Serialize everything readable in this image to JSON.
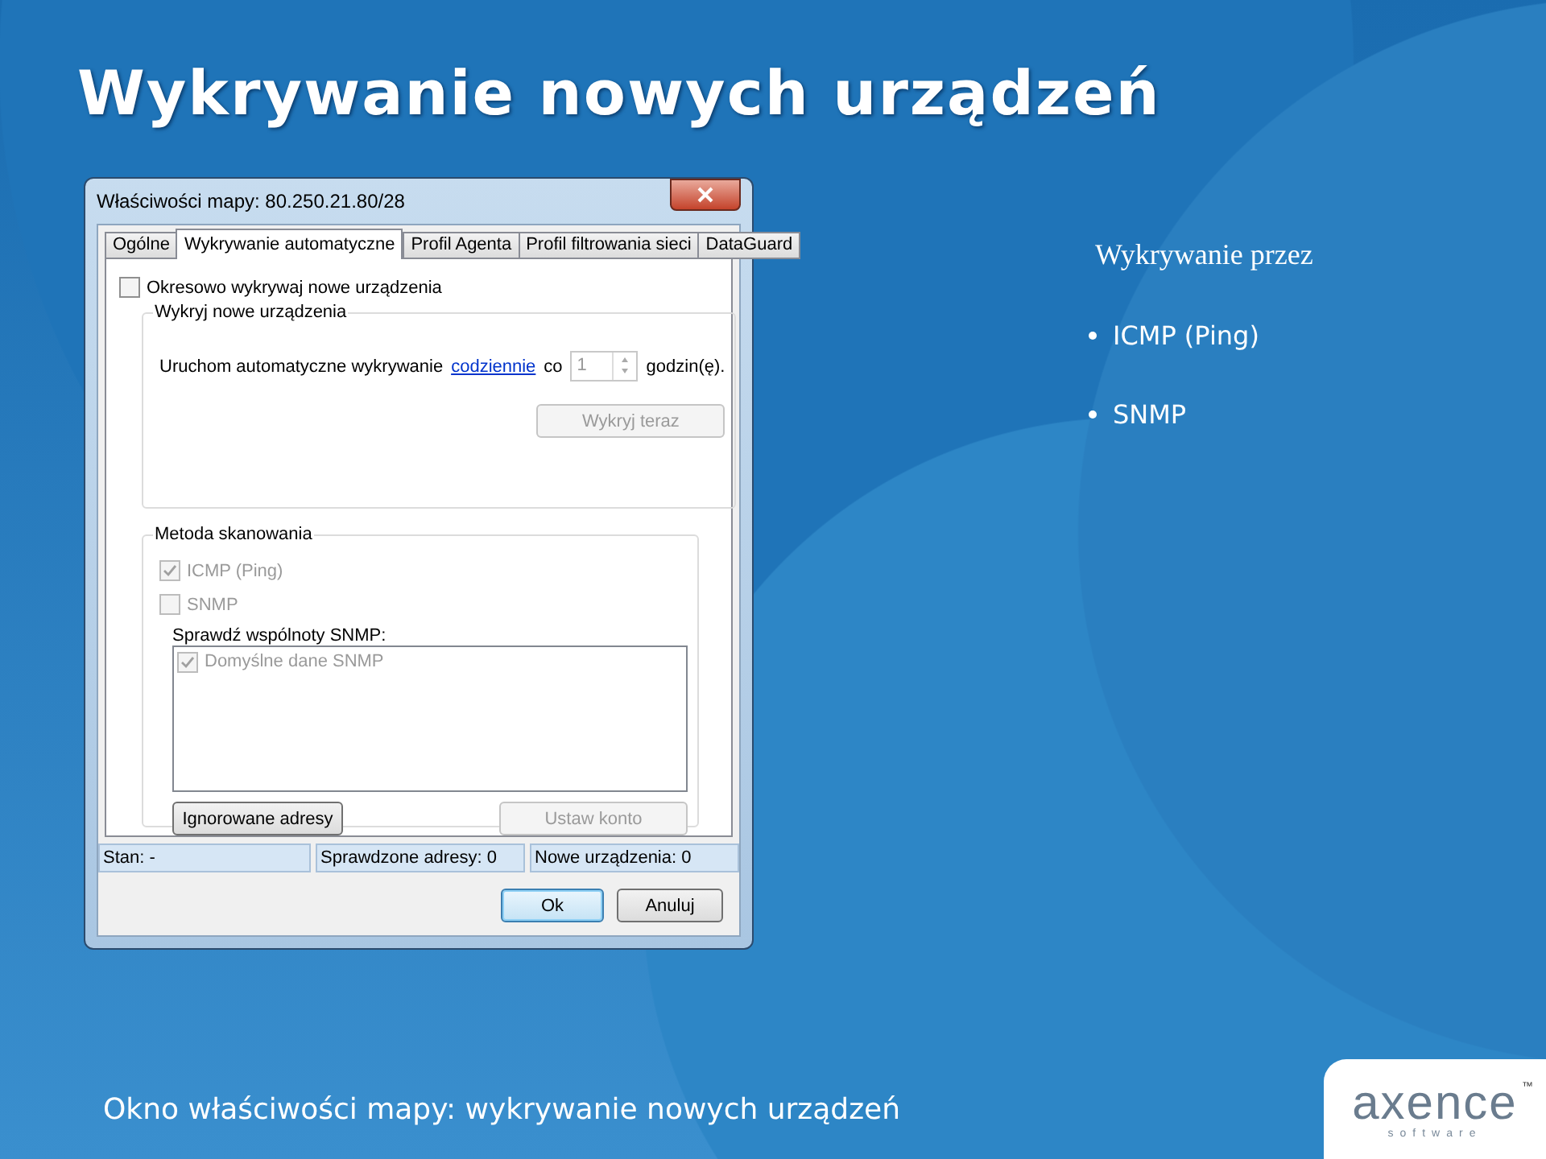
{
  "slide": {
    "title": "Wykrywanie nowych urządzeń",
    "caption": "Okno właściwości mapy: wykrywanie nowych urządzeń"
  },
  "dialog": {
    "title": "Właściwości mapy: 80.250.21.80/28",
    "tabs": [
      {
        "label": "Ogólne",
        "selected": false
      },
      {
        "label": "Wykrywanie automatyczne",
        "selected": true
      },
      {
        "label": "Profil Agenta",
        "selected": false
      },
      {
        "label": "Profil filtrowania sieci",
        "selected": false
      },
      {
        "label": "DataGuard",
        "selected": false
      }
    ],
    "periodic": {
      "label": "Okresowo wykrywaj nowe urządzenia",
      "checked": false,
      "disabled": false
    },
    "detect_group": {
      "legend": "Wykryj nowe urządzenia",
      "prefix": "Uruchom automatyczne wykrywanie",
      "link": "codziennie",
      "middle": "co",
      "spin_value": "1",
      "suffix": "godzin(ę).",
      "button": {
        "label": "Wykryj teraz",
        "disabled": true
      }
    },
    "scan_group": {
      "legend": "Metoda skanowania",
      "methods": [
        {
          "label": "ICMP (Ping)",
          "checked": true,
          "disabled": true
        },
        {
          "label": "SNMP",
          "checked": false,
          "disabled": true
        }
      ],
      "communities_label": "Sprawdź wspólnoty SNMP:",
      "communities": [
        {
          "label": "Domyślne dane SNMP",
          "checked": true,
          "disabled": true
        }
      ],
      "buttons": [
        {
          "label": "Ignorowane adresy",
          "disabled": false
        },
        {
          "label": "Ustaw konto",
          "disabled": true
        }
      ]
    },
    "status": [
      "Stan: -",
      "Sprawdzone adresy: 0",
      "Nowe urządzenia: 0"
    ],
    "buttons": [
      {
        "label": "Ok",
        "default": true
      },
      {
        "label": "Anuluj",
        "default": false
      }
    ]
  },
  "bullets": {
    "heading": "Wykrywanie przez",
    "items": [
      "ICMP (Ping)",
      "SNMP"
    ]
  },
  "logo": {
    "name": "axence",
    "tagline": "software",
    "mark": "™"
  }
}
